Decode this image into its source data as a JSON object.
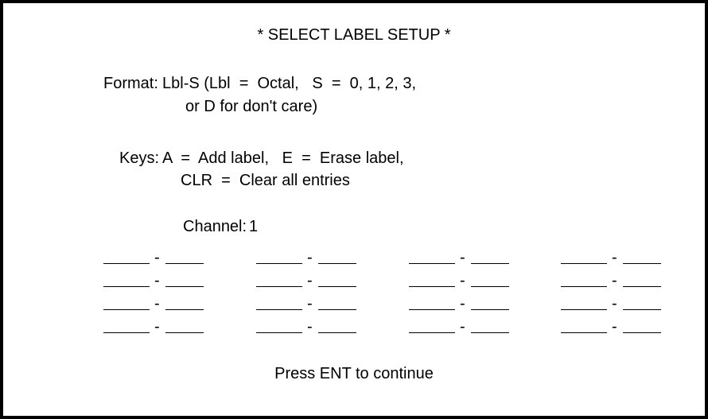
{
  "screen": {
    "title": "* SELECT LABEL SETUP *",
    "format": {
      "label": "Format:",
      "line1": "Lbl-S (Lbl  =  Octal,   S  =  0, 1, 2, 3,",
      "line2": "or D for don't care)"
    },
    "keys": {
      "label": "Keys:",
      "line1": "A  =  Add label,   E  =  Erase label,",
      "line2": "CLR  =  Clear all entries"
    },
    "channel": {
      "label": "Channel:",
      "value": "1"
    },
    "entry_separator": "-",
    "entry_grid": {
      "rows": 4,
      "columns": 4
    },
    "footer": "Press ENT to continue"
  },
  "colors": {
    "foreground": "#000000",
    "background": "#ffffff",
    "border": "#000000"
  }
}
